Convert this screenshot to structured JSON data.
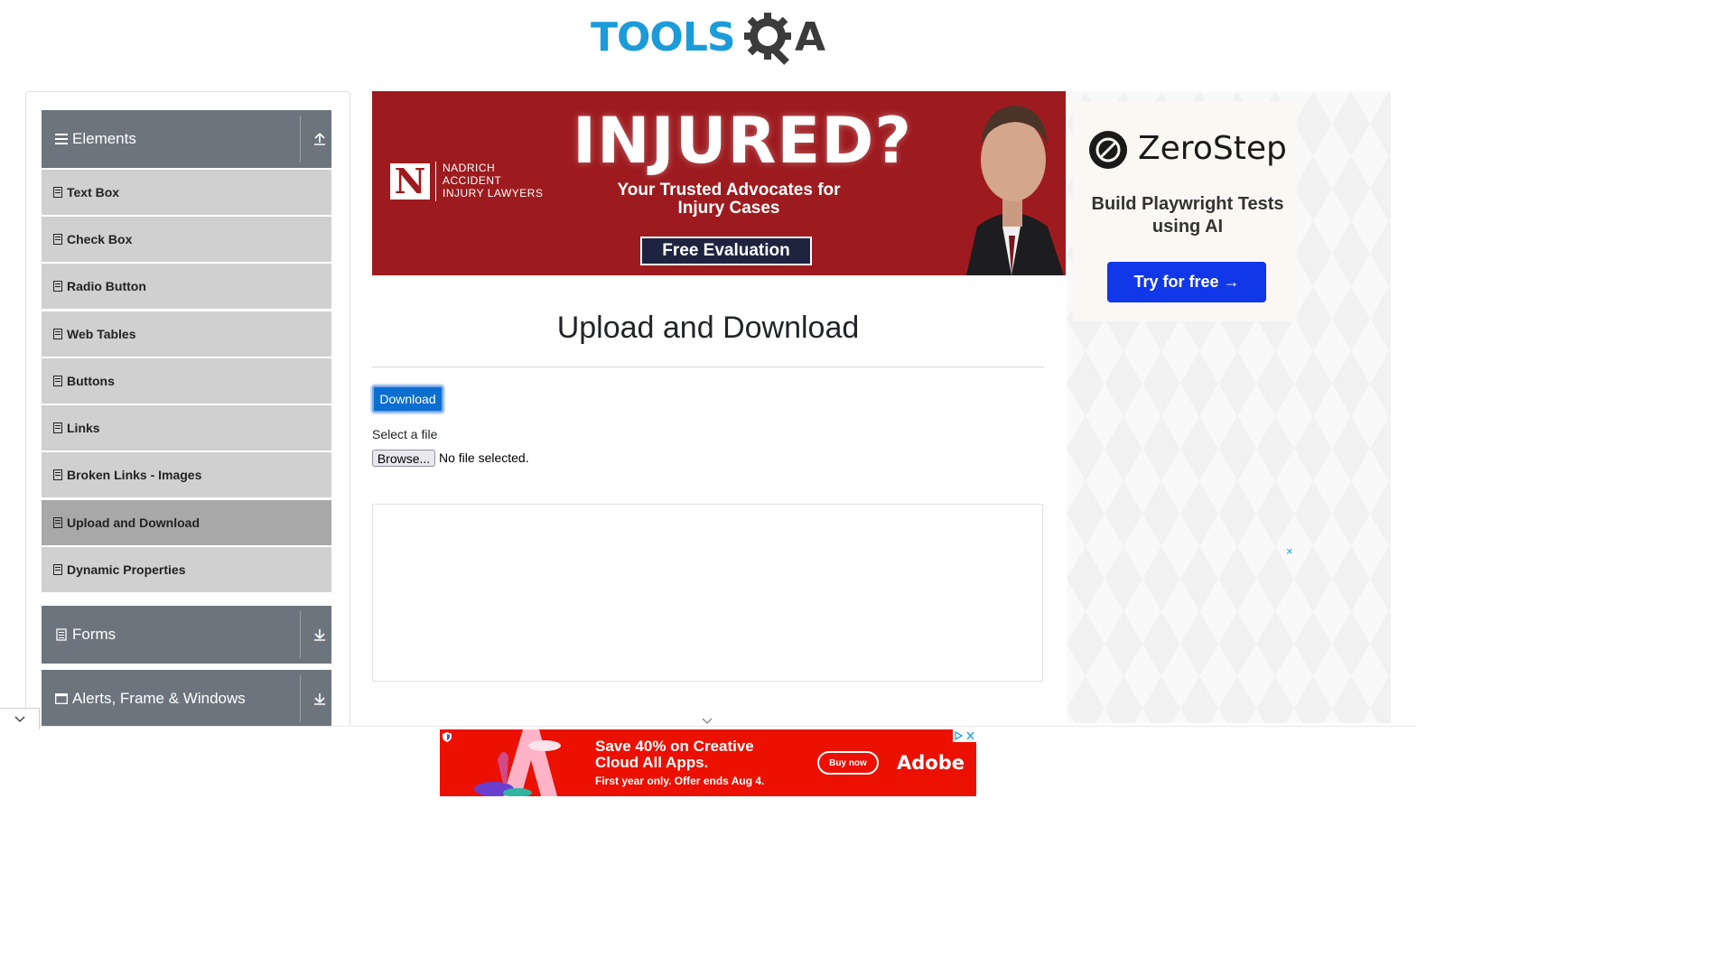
{
  "header": {
    "logo_tools": "TOOLS",
    "logo_a": "A"
  },
  "sidebar": {
    "groups": [
      {
        "title": "Elements"
      },
      {
        "title": "Forms"
      },
      {
        "title": "Alerts, Frame & Windows"
      }
    ],
    "items": [
      {
        "label": "Text Box"
      },
      {
        "label": "Check Box"
      },
      {
        "label": "Radio Button"
      },
      {
        "label": "Web Tables"
      },
      {
        "label": "Buttons"
      },
      {
        "label": "Links"
      },
      {
        "label": "Broken Links - Images"
      },
      {
        "label": "Upload and Download"
      },
      {
        "label": "Dynamic Properties"
      }
    ]
  },
  "top_ad": {
    "n_mark": "N",
    "firm": "NADRICH\nACCIDENT\nINJURY LAWYERS",
    "headline": "INJURED?",
    "subline": "Your Trusted Advocates for Injury Cases",
    "cta": "Free Evaluation"
  },
  "main": {
    "title": "Upload and Download",
    "download_label": "Download",
    "select_label": "Select a file",
    "browse_label": "Browse...",
    "no_file": "No file selected."
  },
  "right_ad": {
    "brand": "ZeroStep",
    "tagline": "Build Playwright Tests using AI",
    "cta": "Try for free →",
    "close": "×"
  },
  "bottom_ad": {
    "headline": "Save 40% on Creative Cloud All Apps.",
    "fineprint": "First year only. Offer ends Aug 4.",
    "buy": "Buy now",
    "brand": "Adobe"
  },
  "colors": {
    "accent": "#0a6ed1",
    "sidebar_header": "#6c757d",
    "ad_red": "#9d1b1f",
    "adobe_red": "#eb1000",
    "zerostep_blue": "#1037e8"
  }
}
